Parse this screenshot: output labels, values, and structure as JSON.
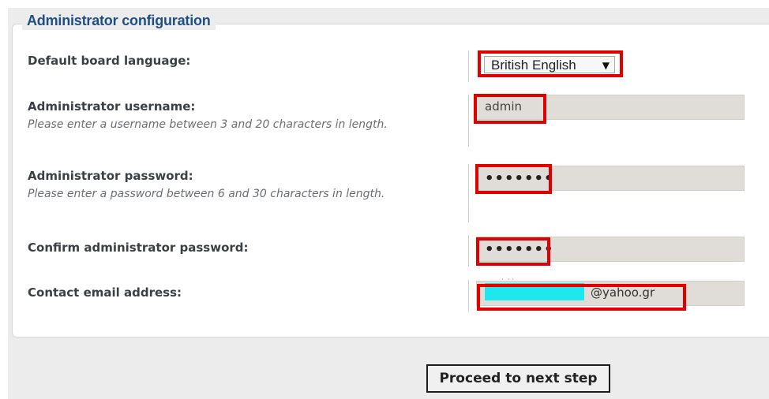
{
  "section": {
    "title": "Administrator configuration"
  },
  "fields": {
    "language": {
      "label": "Default board language:",
      "value": "British English",
      "arrow": "▼"
    },
    "username": {
      "label": "Administrator username:",
      "hint": "Please enter a username between 3 and 20 characters in length.",
      "value": "admin"
    },
    "password": {
      "label": "Administrator password:",
      "hint": "Please enter a password between 6 and 30 characters in length.",
      "masked_value": "•••••••"
    },
    "confirm_password": {
      "label": "Confirm administrator password:",
      "masked_value": "•••••••"
    },
    "email": {
      "label": "Contact email address:",
      "value_suffix": "@yahoo.gr",
      "redaction_color": "#1ee8ee"
    }
  },
  "actions": {
    "next_label": "Proceed to next step"
  },
  "colors": {
    "highlight_red": "#e10000",
    "legend_blue": "#1d4f86",
    "input_bg": "#e0ddd8"
  }
}
